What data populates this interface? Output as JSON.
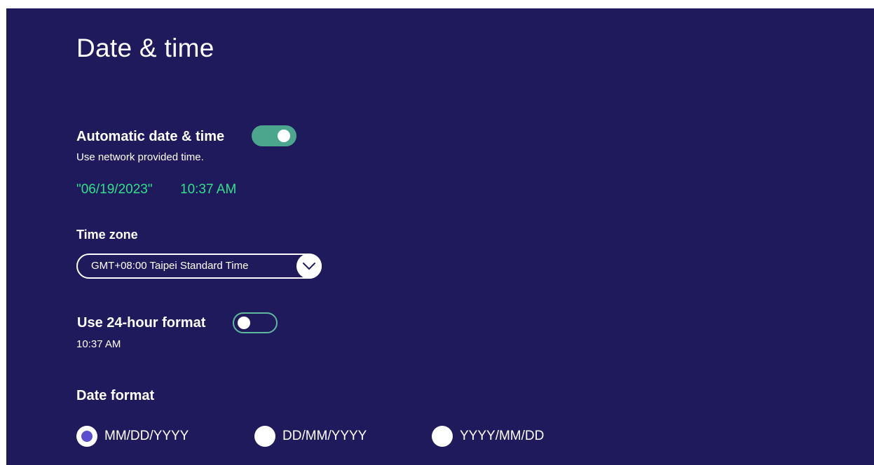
{
  "page": {
    "title": "Date & time"
  },
  "automatic_date_time": {
    "label": "Automatic date & time",
    "description": "Use network provided time.",
    "enabled": true,
    "current_date": "\"06/19/2023\"",
    "current_time": "10:37 AM"
  },
  "time_zone": {
    "label": "Time zone",
    "selected": "GMT+08:00 Taipei Standard Time",
    "chevron_icon": "chevron-down-icon"
  },
  "hour_format": {
    "label": "Use 24-hour format",
    "enabled": false,
    "preview": "10:37 AM"
  },
  "date_format": {
    "label": "Date format",
    "options": [
      {
        "label": "MM/DD/YYYY",
        "selected": true
      },
      {
        "label": "DD/MM/YYYY",
        "selected": false
      },
      {
        "label": "YYYY/MM/DD",
        "selected": false
      }
    ]
  },
  "colors": {
    "background": "#1e1a5c",
    "toggle_on": "#4ca58d",
    "accent_text": "#33e08a",
    "radio_selected": "#5a4fcf"
  }
}
